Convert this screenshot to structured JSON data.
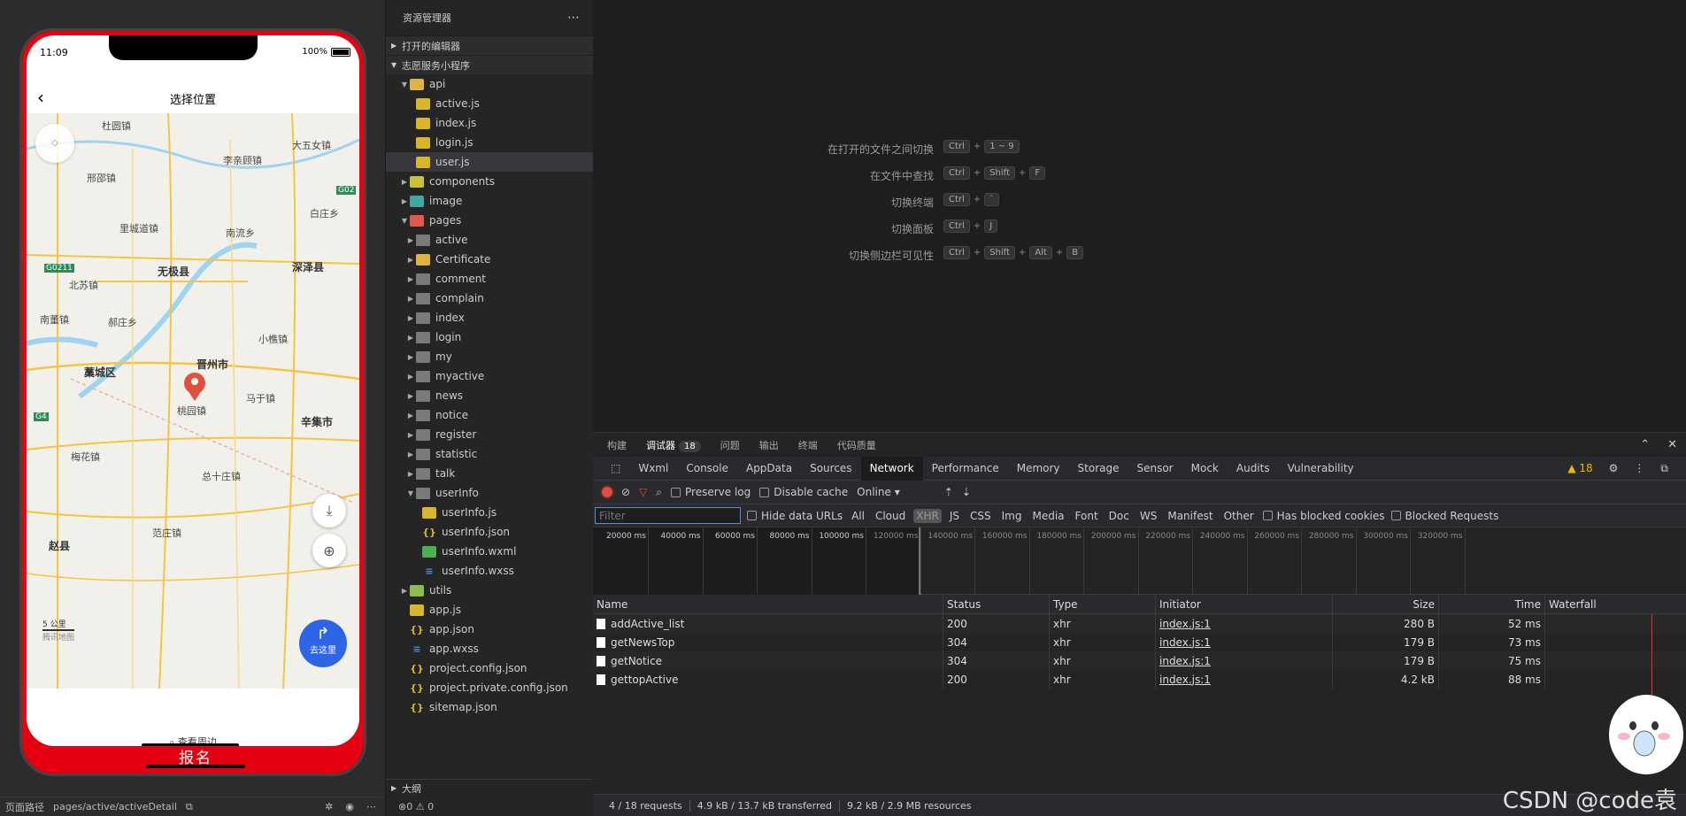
{
  "simulator": {
    "status_time": "11:09",
    "battery_pct": "100%",
    "nav_title": "选择位置",
    "map_labels": [
      "杜圆镇",
      "大五女镇",
      "李亲顾镇",
      "邢邵镇",
      "G02",
      "白庄乡",
      "里城道镇",
      "南流乡",
      "G0211",
      "无极县",
      "深泽县",
      "北苏镇",
      "南董镇",
      "郝庄乡",
      "小樵镇",
      "晋州市",
      "藁城区",
      "马于镇",
      "桃园镇",
      "辛集市",
      "G4",
      "梅花镇",
      "总十庄镇",
      "范庄镇",
      "赵县"
    ],
    "go_button": "去这里",
    "scale": "5 公里",
    "map_brand": "腾讯地图",
    "nearby": "查看周边",
    "signup": "报名",
    "footer_path_label": "页面路径",
    "footer_path": "pages/active/activeDetail"
  },
  "explorer": {
    "title": "资源管理器",
    "open_editors": "打开的编辑器",
    "project": "志愿服务小程序",
    "tree": [
      {
        "label": "api",
        "depth": 1,
        "icon": "folder-api",
        "twisty": "▼"
      },
      {
        "label": "active.js",
        "depth": 2,
        "icon": "js",
        "twisty": ""
      },
      {
        "label": "index.js",
        "depth": 2,
        "icon": "js",
        "twisty": ""
      },
      {
        "label": "login.js",
        "depth": 2,
        "icon": "js",
        "twisty": ""
      },
      {
        "label": "user.js",
        "depth": 2,
        "icon": "js",
        "twisty": "",
        "selected": true
      },
      {
        "label": "components",
        "depth": 1,
        "icon": "folder-comp",
        "twisty": "▶"
      },
      {
        "label": "image",
        "depth": 1,
        "icon": "folder-img",
        "twisty": "▶"
      },
      {
        "label": "pages",
        "depth": 1,
        "icon": "folder-pages",
        "twisty": "▼"
      },
      {
        "label": "active",
        "depth": 2,
        "icon": "folder",
        "twisty": "▶"
      },
      {
        "label": "Certificate",
        "depth": 2,
        "icon": "folder-cert",
        "twisty": "▶"
      },
      {
        "label": "comment",
        "depth": 2,
        "icon": "folder",
        "twisty": "▶"
      },
      {
        "label": "complain",
        "depth": 2,
        "icon": "folder",
        "twisty": "▶"
      },
      {
        "label": "index",
        "depth": 2,
        "icon": "folder",
        "twisty": "▶"
      },
      {
        "label": "login",
        "depth": 2,
        "icon": "folder",
        "twisty": "▶"
      },
      {
        "label": "my",
        "depth": 2,
        "icon": "folder",
        "twisty": "▶"
      },
      {
        "label": "myactive",
        "depth": 2,
        "icon": "folder",
        "twisty": "▶"
      },
      {
        "label": "news",
        "depth": 2,
        "icon": "folder",
        "twisty": "▶"
      },
      {
        "label": "notice",
        "depth": 2,
        "icon": "folder",
        "twisty": "▶"
      },
      {
        "label": "register",
        "depth": 2,
        "icon": "folder",
        "twisty": "▶"
      },
      {
        "label": "statistic",
        "depth": 2,
        "icon": "folder",
        "twisty": "▶"
      },
      {
        "label": "talk",
        "depth": 2,
        "icon": "folder",
        "twisty": "▶"
      },
      {
        "label": "userInfo",
        "depth": 2,
        "icon": "folder",
        "twisty": "▼"
      },
      {
        "label": "userInfo.js",
        "depth": 3,
        "icon": "js",
        "twisty": ""
      },
      {
        "label": "userInfo.json",
        "depth": 3,
        "icon": "json",
        "twisty": ""
      },
      {
        "label": "userInfo.wxml",
        "depth": 3,
        "icon": "wxml",
        "twisty": ""
      },
      {
        "label": "userInfo.wxss",
        "depth": 3,
        "icon": "wxss",
        "twisty": ""
      },
      {
        "label": "utils",
        "depth": 1,
        "icon": "folder-utils",
        "twisty": "▶"
      },
      {
        "label": "app.js",
        "depth": 1,
        "icon": "js",
        "twisty": ""
      },
      {
        "label": "app.json",
        "depth": 1,
        "icon": "json",
        "twisty": ""
      },
      {
        "label": "app.wxss",
        "depth": 1,
        "icon": "wxss",
        "twisty": ""
      },
      {
        "label": "project.config.json",
        "depth": 1,
        "icon": "json",
        "twisty": ""
      },
      {
        "label": "project.private.config.json",
        "depth": 1,
        "icon": "json",
        "twisty": ""
      },
      {
        "label": "sitemap.json",
        "depth": 1,
        "icon": "json",
        "twisty": ""
      }
    ],
    "outline": "大纲",
    "status": "0 ⚠ 0"
  },
  "shortcuts": [
    {
      "label": "在打开的文件之间切换",
      "keys": [
        "Ctrl",
        "1 ~ 9"
      ]
    },
    {
      "label": "在文件中查找",
      "keys": [
        "Ctrl",
        "Shift",
        "F"
      ]
    },
    {
      "label": "切换终端",
      "keys": [
        "Ctrl",
        "`"
      ]
    },
    {
      "label": "切换面板",
      "keys": [
        "Ctrl",
        "J"
      ]
    },
    {
      "label": "切换侧边栏可见性",
      "keys": [
        "Ctrl",
        "Shift",
        "Alt",
        "B"
      ]
    }
  ],
  "devtools": {
    "top_tabs": [
      "构建",
      "调试器",
      "问题",
      "输出",
      "终端",
      "代码质量"
    ],
    "debugger_badge": "18",
    "panel_tabs": [
      "Wxml",
      "Console",
      "AppData",
      "Sources",
      "Network",
      "Performance",
      "Memory",
      "Storage",
      "Sensor",
      "Mock",
      "Audits",
      "Vulnerability"
    ],
    "active_panel": "Network",
    "warnings": "18",
    "toolbar": {
      "preserve_log": "Preserve log",
      "disable_cache": "Disable cache",
      "throttle": "Online"
    },
    "filter": {
      "placeholder": "Filter",
      "hide_data_urls": "Hide data URLs",
      "types": [
        "All",
        "Cloud",
        "XHR",
        "JS",
        "CSS",
        "Img",
        "Media",
        "Font",
        "Doc",
        "WS",
        "Manifest",
        "Other"
      ],
      "active_type": "XHR",
      "has_blocked": "Has blocked cookies",
      "blocked_requests": "Blocked Requests"
    },
    "ticks": [
      "20000 ms",
      "40000 ms",
      "60000 ms",
      "80000 ms",
      "100000 ms",
      "120000 ms",
      "140000 ms",
      "160000 ms",
      "180000 ms",
      "200000 ms",
      "220000 ms",
      "240000 ms",
      "260000 ms",
      "280000 ms",
      "300000 ms",
      "320000 ms"
    ],
    "columns": [
      "Name",
      "Status",
      "Type",
      "Initiator",
      "Size",
      "Time",
      "Waterfall"
    ],
    "rows": [
      {
        "name": "addActive_list",
        "status": "200",
        "type": "xhr",
        "initiator": "index.js:1",
        "size": "280 B",
        "time": "52 ms"
      },
      {
        "name": "getNewsTop",
        "status": "304",
        "type": "xhr",
        "initiator": "index.js:1",
        "size": "179 B",
        "time": "73 ms"
      },
      {
        "name": "getNotice",
        "status": "304",
        "type": "xhr",
        "initiator": "index.js:1",
        "size": "179 B",
        "time": "75 ms"
      },
      {
        "name": "gettopActive",
        "status": "200",
        "type": "xhr",
        "initiator": "index.js:1",
        "size": "4.2 kB",
        "time": "88 ms"
      }
    ],
    "summary": [
      "4 / 18 requests",
      "4.9 kB / 13.7 kB transferred",
      "9.2 kB / 2.9 MB resources"
    ]
  },
  "watermark": "CSDN @code袁",
  "colors": {
    "accent_red": "#e50012",
    "go_blue": "#2e64e6",
    "record": "#e64a3c"
  }
}
